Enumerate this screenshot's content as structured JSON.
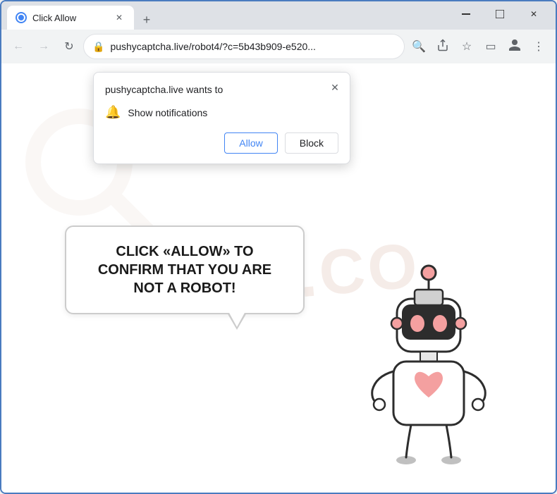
{
  "browser": {
    "tab_title": "Click Allow",
    "new_tab_icon": "+",
    "window_controls": {
      "minimize": "—",
      "maximize": "□",
      "close": "✕"
    }
  },
  "navbar": {
    "back_icon": "←",
    "forward_icon": "→",
    "reload_icon": "↻",
    "address": "pushycaptcha.live/robot4/?c=5b43b909-e520...",
    "search_icon": "🔍",
    "share_icon": "⬆",
    "bookmark_icon": "☆",
    "split_icon": "▭",
    "profile_icon": "👤",
    "menu_icon": "⋮"
  },
  "notification_popup": {
    "header": "pushycaptcha.live wants to",
    "close_icon": "✕",
    "row_icon": "🔔",
    "row_text": "Show notifications",
    "allow_btn": "Allow",
    "block_btn": "Block"
  },
  "speech_bubble": {
    "text": "CLICK «ALLOW» TO CONFIRM THAT YOU ARE NOT A ROBOT!"
  },
  "watermark": {
    "text": "RISK.CO"
  },
  "colors": {
    "accent": "#4285f4",
    "border": "#4a7bbf",
    "allow_color": "#4285f4",
    "bubble_text": "#1a1a1a",
    "watermark_color": "#c89680"
  }
}
